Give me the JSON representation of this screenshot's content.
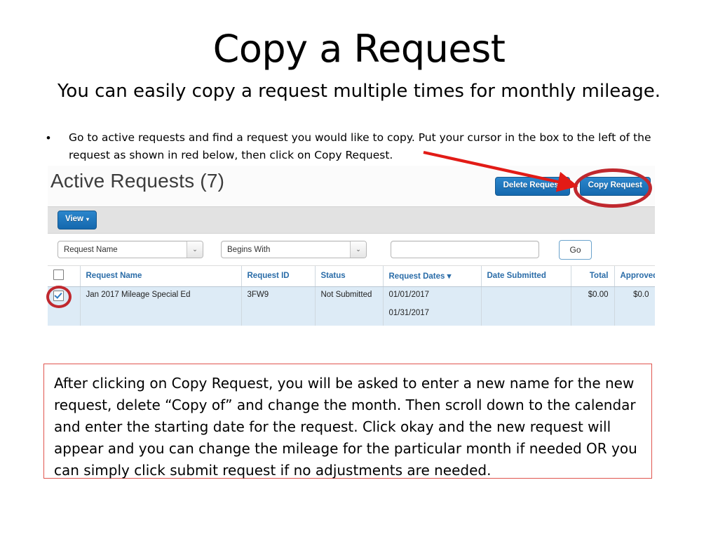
{
  "slide": {
    "title": "Copy a Request",
    "subtitle": "You can easily copy a request multiple times for monthly mileage.",
    "bullet_marker": "•",
    "bullet_text": "Go to active requests and find a request you would like to copy.  Put your cursor in the box to the left of the request as shown in red below, then click on Copy Request.",
    "note_text": "After clicking on Copy Request, you will be asked to enter a new name for the new request, delete “Copy of” and change the month.  Then scroll down to the calendar and enter the starting date for the request.  Click okay and the new request will appear and you can change the mileage for the particular month if needed OR you can simply click submit request if no adjustments are needed."
  },
  "app": {
    "heading": "Active Requests (7)",
    "buttons": {
      "delete_request": "Delete Request",
      "copy_request": "Copy Request",
      "view": "View",
      "view_caret": "▾",
      "go": "Go"
    },
    "filters": {
      "field_select_value": "Request Name",
      "operator_select_value": "Begins With",
      "search_value": "",
      "search_placeholder": "",
      "select_caret": "⌄"
    },
    "table": {
      "headers": [
        "",
        "Request Name",
        "Request ID",
        "Status",
        "Request Dates ▾",
        "Date Submitted",
        "Total",
        "Approved a"
      ],
      "rows": [
        {
          "checked": true,
          "request_name": "Jan 2017 Mileage Special Ed",
          "request_id": "3FW9",
          "status": "Not Submitted",
          "request_date_start": "01/01/2017",
          "request_date_end": "01/31/2017",
          "date_submitted": "",
          "total": "$0.00",
          "approved": "$0.0"
        }
      ]
    }
  },
  "annotations": {
    "highlight_color": "#c0282e",
    "note_border_color": "#e0554f",
    "button_color": "#1d74ba",
    "row_highlight_color": "#ddebf6",
    "header_text_color": "#2a6ca8"
  }
}
